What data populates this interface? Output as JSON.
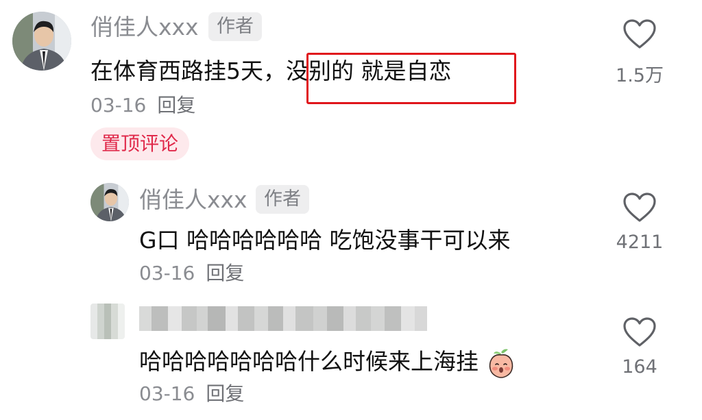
{
  "comments": [
    {
      "username": "俏佳人xxx",
      "author_tag": "作者",
      "text_prefix": "在体育西路挂5天，",
      "text_highlight": "没别的 就是自恋",
      "date": "03-16",
      "reply_label": "回复",
      "pinned_label": "置顶评论",
      "like_count": "1.5万",
      "like_icon": "heart-outline-icon"
    },
    {
      "username": "俏佳人xxx",
      "author_tag": "作者",
      "text": "G口 哈哈哈哈哈哈 吃饱没事干可以来",
      "date": "03-16",
      "reply_label": "回复",
      "like_count": "4211",
      "like_icon": "heart-outline-icon"
    },
    {
      "username_blurred": true,
      "text": "哈哈哈哈哈哈哈什么时候来上海挂",
      "emoji": "peach-face-emoji",
      "date": "03-16",
      "reply_label": "回复",
      "like_count": "164",
      "like_icon": "heart-outline-icon"
    }
  ],
  "colors": {
    "username": "#8a8c91",
    "text": "#111111",
    "pinned_tag_text": "#e0294a",
    "pinned_tag_bg": "#fde9ec",
    "highlight_box": "#e0151b",
    "author_tag_bg": "#eeeeef"
  }
}
